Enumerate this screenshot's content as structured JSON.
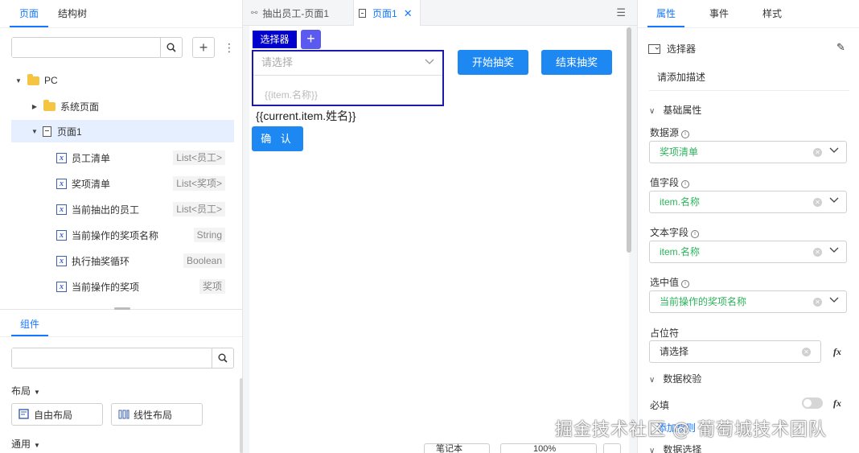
{
  "left": {
    "tabs": [
      "页面",
      "结构树"
    ],
    "tree": {
      "root": "PC",
      "system": "系统页面",
      "page": "页面1",
      "vars": [
        {
          "name": "员工清单",
          "type": "List<员工>"
        },
        {
          "name": "奖项清单",
          "type": "List<奖项>"
        },
        {
          "name": "当前抽出的员工",
          "type": "List<员工>"
        },
        {
          "name": "当前操作的奖项名称",
          "type": "String"
        },
        {
          "name": "执行抽奖循环",
          "type": "Boolean"
        },
        {
          "name": "当前操作的奖项",
          "type": "奖项"
        }
      ]
    },
    "components_tab": "组件",
    "sections": {
      "layout": "布局",
      "common": "通用"
    },
    "layout_items": [
      "自由布局",
      "线性布局"
    ]
  },
  "center": {
    "tabs": [
      "抽出员工-页面1",
      "页面1"
    ],
    "selector_tag": "选择器",
    "select_placeholder": "请选择",
    "select_option": "{{item.名称}}",
    "btn_start": "开始抽奖",
    "btn_end": "结束抽奖",
    "expr": "{{current.item.姓名}}",
    "btn_confirm": "确 认",
    "bottom": {
      "note": "笔记本",
      "zoom": "100%"
    }
  },
  "right": {
    "tabs": [
      "属性",
      "事件",
      "样式"
    ],
    "component": "选择器",
    "desc": "请添加描述",
    "basic": "基础属性",
    "fields": [
      {
        "label": "数据源",
        "value": "奖项清单"
      },
      {
        "label": "值字段",
        "value": "item.名称"
      },
      {
        "label": "文本字段",
        "value": "item.名称"
      },
      {
        "label": "选中值",
        "value": "当前操作的奖项名称"
      }
    ],
    "placeholder_label": "占位符",
    "placeholder_value": "请选择",
    "validate": "数据校验",
    "required": "必填",
    "link_text": "添加规则",
    "data_select": "数据选择",
    "fx": "fx"
  },
  "watermark": "掘金技术社区 @ 葡萄城技术团队",
  "colors": {
    "accent": "#1677ff",
    "button": "#1e88f2",
    "select_border": "#1a1ab0",
    "green": "#2bb35a"
  }
}
